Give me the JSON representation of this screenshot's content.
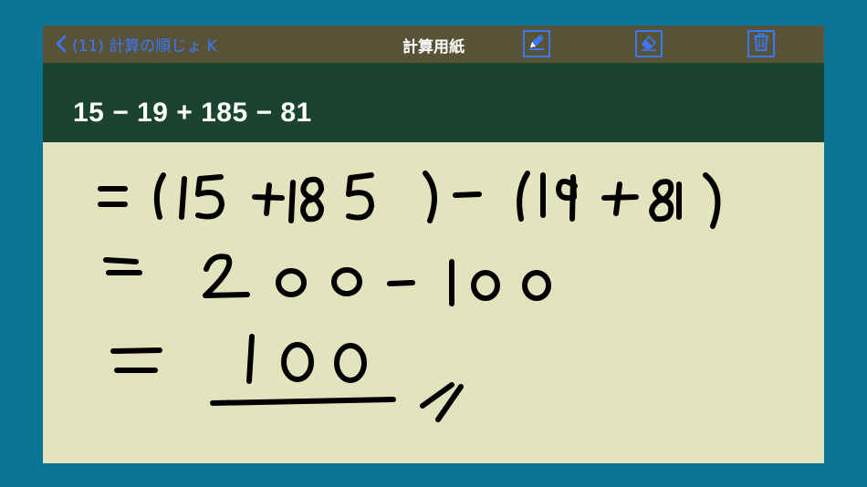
{
  "navbar": {
    "back_label": "(11) 計算の順じょ K",
    "title": "計算用紙",
    "tools": [
      "pencil-icon",
      "eraser-icon",
      "trash-icon"
    ],
    "accent_color": "#3a79ff",
    "background_color": "#585237"
  },
  "problem": {
    "expression": "15 − 19 + 185 − 81",
    "background_color": "#1a4430"
  },
  "scratchpad": {
    "background_color": "#e3e3bd",
    "handwritten_lines": [
      "=(15+185)-(19+81)",
      "=  200-100",
      "=  100 //"
    ]
  }
}
